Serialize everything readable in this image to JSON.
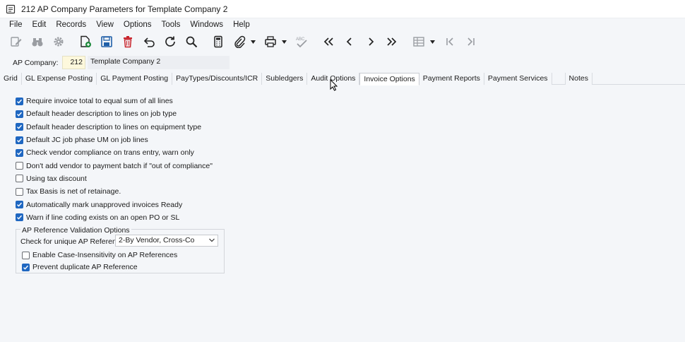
{
  "window": {
    "title": "212 AP Company Parameters for Template Company 2"
  },
  "menu": [
    "File",
    "Edit",
    "Records",
    "View",
    "Options",
    "Tools",
    "Windows",
    "Help"
  ],
  "toolbar_icons": [
    "edit-icon",
    "binoculars-icon",
    "gear-icon",
    "new-record-icon",
    "save-icon",
    "delete-icon",
    "undo-icon",
    "refresh-icon",
    "search-icon",
    "calculator-icon",
    "attachment-icon",
    "print-icon",
    "spellcheck-icon",
    "first-record-icon",
    "previous-record-icon",
    "next-record-icon",
    "last-record-icon",
    "grid-icon",
    "first-page-icon",
    "last-page-icon"
  ],
  "company": {
    "label": "AP Company:",
    "number": "212",
    "name": "Template Company 2"
  },
  "tabs": [
    "Grid",
    "GL Expense Posting",
    "GL Payment Posting",
    "PayTypes/Discounts/ICR",
    "Subledgers",
    "Audit Options",
    "Invoice Options",
    "Payment Reports",
    "Payment Services",
    "Notes"
  ],
  "active_tab": "Invoice Options",
  "options": [
    {
      "label": "Require invoice total to equal sum of all lines",
      "checked": true
    },
    {
      "label": "Default header description to lines on job type",
      "checked": true
    },
    {
      "label": "Default header description to lines on equipment type",
      "checked": true
    },
    {
      "label": "Default JC job phase UM on job lines",
      "checked": true
    },
    {
      "label": "Check vendor compliance on trans entry, warn only",
      "checked": true
    },
    {
      "label": "Don't add vendor to payment batch if \"out of compliance\"",
      "checked": false
    },
    {
      "label": "Using tax discount",
      "checked": false
    },
    {
      "label": "Tax Basis is net of retainage.",
      "checked": false
    },
    {
      "label": "Automatically mark unapproved invoices Ready",
      "checked": true
    },
    {
      "label": "Warn if line coding exists on an open PO or SL",
      "checked": true
    }
  ],
  "ap_reference": {
    "group_title": "AP Reference Validation Options",
    "check_label": "Check for unique AP Reference:",
    "selected": "2-By Vendor, Cross-Co",
    "case_insensitive": {
      "label": "Enable Case-Insensitivity on AP References",
      "checked": false
    },
    "prevent_duplicate": {
      "label": "Prevent duplicate AP Reference",
      "checked": true
    }
  },
  "colors": {
    "accent": "#1f67c1",
    "company_field": "#fdf8dc",
    "background": "#f4f6f9"
  }
}
